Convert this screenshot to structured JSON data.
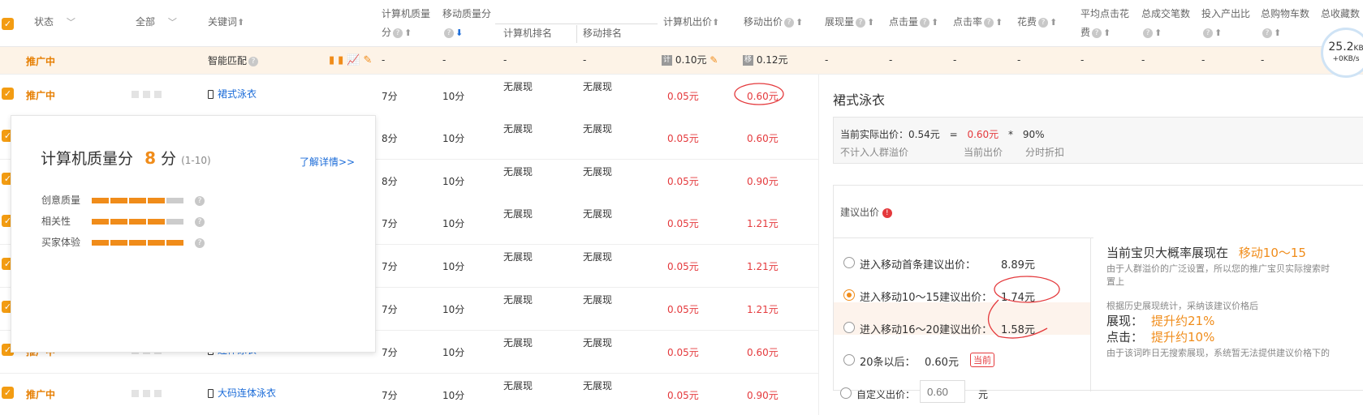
{
  "header": {
    "status": "状态",
    "all": "全部",
    "keyword": "关键词",
    "pc_quality": "计算机质量",
    "pc_quality2": "分",
    "mobile_quality": "移动质量分",
    "pc_rank": "计算机排名",
    "mobile_rank": "移动排名",
    "pc_bid": "计算机出价",
    "mobile_bid": "移动出价",
    "impressions": "展现量",
    "clicks": "点击量",
    "ctr": "点击率",
    "cost": "花费",
    "avg_cpc": "平均点击花",
    "avg_cpc2": "费",
    "total_deals": "总成交笔数",
    "roi": "投入产出比",
    "total_cart": "总购物车数",
    "total_fav": "总收藏数"
  },
  "smart_row": {
    "status": "推广中",
    "keyword": "智能匹配",
    "pc_quality": "-",
    "mobile_quality": "-",
    "pc_rank": "-",
    "mobile_rank": "-",
    "pc_bid": "0.10元",
    "mobile_bid": "0.12元",
    "dashes": [
      "-",
      "-",
      "-",
      "-",
      "-",
      "-",
      "-",
      "-"
    ]
  },
  "rows": [
    {
      "status": "推广中",
      "keyword": "裙式泳衣",
      "pc_q": "7分",
      "m_q": "10分",
      "pc_rank": "无展现",
      "m_rank": "无展现",
      "pc_bid": "0.05元",
      "m_bid": "0.60元"
    },
    {
      "status": "",
      "keyword": "",
      "pc_q": "8分",
      "m_q": "10分",
      "pc_rank": "无展现",
      "m_rank": "无展现",
      "pc_bid": "0.05元",
      "m_bid": "0.60元"
    },
    {
      "status": "",
      "keyword": "",
      "pc_q": "8分",
      "m_q": "10分",
      "pc_rank": "无展现",
      "m_rank": "无展现",
      "pc_bid": "0.05元",
      "m_bid": "0.90元"
    },
    {
      "status": "",
      "keyword": "",
      "pc_q": "7分",
      "m_q": "10分",
      "pc_rank": "无展现",
      "m_rank": "无展现",
      "pc_bid": "0.05元",
      "m_bid": "1.21元"
    },
    {
      "status": "",
      "keyword": "",
      "pc_q": "7分",
      "m_q": "10分",
      "pc_rank": "无展现",
      "m_rank": "无展现",
      "pc_bid": "0.05元",
      "m_bid": "1.21元"
    },
    {
      "status": "",
      "keyword": "",
      "pc_q": "7分",
      "m_q": "10分",
      "pc_rank": "无展现",
      "m_rank": "无展现",
      "pc_bid": "0.05元",
      "m_bid": "1.21元"
    },
    {
      "status": "推广中",
      "keyword": "连体泳衣",
      "pc_q": "7分",
      "m_q": "10分",
      "pc_rank": "无展现",
      "m_rank": "无展现",
      "pc_bid": "0.05元",
      "m_bid": "0.60元"
    },
    {
      "status": "推广中",
      "keyword": "大码连体泳衣",
      "pc_q": "7分",
      "m_q": "10分",
      "pc_rank": "无展现",
      "m_rank": "无展现",
      "pc_bid": "0.05元",
      "m_bid": "0.90元"
    }
  ],
  "popover": {
    "title": "计算机质量分",
    "score": "8",
    "unit": "分",
    "range": "(1-10)",
    "link": "了解详情>>",
    "items": [
      {
        "label": "创意质量",
        "level": 4
      },
      {
        "label": "相关性",
        "level": 4
      },
      {
        "label": "买家体验",
        "level": 5
      }
    ]
  },
  "panel": {
    "title": "裙式泳衣",
    "formula_label": "当前实际出价：0.54元",
    "eq": "=",
    "current_bid": "0.60元",
    "times": "*",
    "discount": "90%",
    "sub1": "不计入人群溢价",
    "sub2": "当前出价",
    "sub3": "分时折扣",
    "suggest_title": "建议出价",
    "options": [
      {
        "label": "进入移动首条建议出价：",
        "value": "8.89元"
      },
      {
        "label": "进入移动10～15建议出价：",
        "value": "1.74元"
      },
      {
        "label": "进入移动16～20建议出价：",
        "value": "1.58元"
      },
      {
        "label": "20条以后：",
        "value": "0.60元",
        "tag": "当前"
      }
    ],
    "right_title": "当前宝贝大概率展现在",
    "right_pos": "移动10～15",
    "right_note": "由于人群溢价的广泛设置，所以您的推广宝贝实际搜索时",
    "right_note2": "置上",
    "hist_note": "根据历史展现统计，采纳该建议价格后",
    "imp_label": "展现：",
    "imp_value": "提升约21%",
    "click_label": "点击：",
    "click_value": "提升约10%",
    "foot_note": "由于该词昨日无搜索展现，系统暂无法提供建议价格下的",
    "custom_label": "自定义出价：",
    "custom_placeholder": "0.60",
    "custom_unit": "元"
  },
  "speed": {
    "value": "25.2",
    "unit": "KB",
    "sub": "+0KB/s"
  },
  "colors": {
    "accent": "#f08c1a",
    "price": "#e4393c",
    "link": "#1a6bd8",
    "status": "#e67e00"
  }
}
